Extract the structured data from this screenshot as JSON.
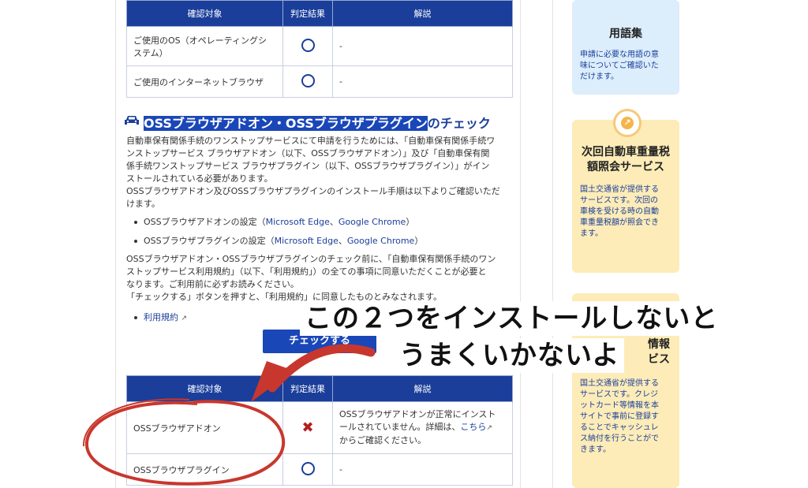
{
  "table_top": {
    "headers": [
      "確認対象",
      "判定結果",
      "解説"
    ],
    "rows": [
      {
        "target_line1": "ご使用のOS（オペレーティングシ",
        "target_line2": "ステム）",
        "note": "-"
      },
      {
        "target": "ご使用のインターネットブラウザ",
        "note": "-"
      }
    ]
  },
  "section": {
    "heading_highlighted": "OSSブラウザアドオン・OSSブラウザプラグイン",
    "heading_rest": "のチェック",
    "intro_lines": [
      "自動車保有関係手続のワンストップサービスにて申請を行うためには、「自動車保有関係手続ワ",
      "ンストップサービス ブラウザアドオン（以下、OSSブラウザアドオン）」及び「自動車保有関",
      "係手続ワンストップサービス ブラウザプラグイン（以下、OSSブラウザプラグイン）」がイン",
      "ストールされている必要があります。",
      "OSSブラウザアドオン及びOSSブラウザプラグインのインストール手順は以下よりご確認いただ",
      "けます。"
    ],
    "bullets": [
      {
        "text": "OSSブラウザアドオンの設定（",
        "link1": "Microsoft Edge",
        "sep": "、",
        "link2": "Google Chrome",
        "end": "）"
      },
      {
        "text": "OSSブラウザプラグインの設定（",
        "link1": "Microsoft Edge",
        "sep": "、",
        "link2": "Google Chrome",
        "end": "）"
      }
    ],
    "notice_lines": [
      "OSSブラウザアドオン・OSSブラウザプラグインのチェック前に、「自動車保有関係手続のワン",
      "ストップサービス利用規約」（以下、「利用規約」）の全ての事項に同意いただくことが必要と",
      "なります。ご利用前に必ずお読みください。",
      "「チェックする」ボタンを押すと、「利用規約」に同意したものとみなされます。"
    ],
    "terms_link": "利用規約",
    "check_button": "チェックする"
  },
  "table_bottom": {
    "headers": [
      "確認対象",
      "判定結果",
      "解説"
    ],
    "rows": [
      {
        "target": "OSSブラウザアドオン",
        "note_line1": "OSSブラウザアドオンが正常にインスト",
        "note_line2": "ールされていません。詳細は、",
        "note_link": "こちら",
        "note_line3": "からご確認ください。"
      },
      {
        "target": "OSSブラウザプラグイン",
        "note": "-"
      }
    ]
  },
  "callout": {
    "line1": "この２つをインストールしないと",
    "line2": "うまくいかないよ"
  },
  "sidebar": {
    "glossary": {
      "title": "用語集",
      "desc": [
        "申請に必要な用語の意",
        "味についてご確認いた",
        "だけます。"
      ]
    },
    "weight_tax": {
      "title_line1": "次回自動車重量税",
      "title_line2": "額照会サービス",
      "desc": [
        "国土交通省が提供する",
        "サービスです。次回の",
        "車検を受ける時の自動",
        "車重量税額が照会でき",
        "ます。"
      ]
    },
    "payment": {
      "title_line1": "情報",
      "title_line2": "ビス",
      "desc": [
        "国土交通省が提供する",
        "サービスです。クレジ",
        "ットカード等情報を本",
        "サイトで事前に登録す",
        "ることでキャッシュレ",
        "ス納付を行うことがで",
        "きます。"
      ]
    }
  },
  "colors": {
    "header_blue": "#1a3e9a",
    "highlight": "#1a47b8",
    "annotation_red": "#c8372d",
    "glossary_bg": "#dcedfb",
    "service_bg": "#fdecb8"
  }
}
